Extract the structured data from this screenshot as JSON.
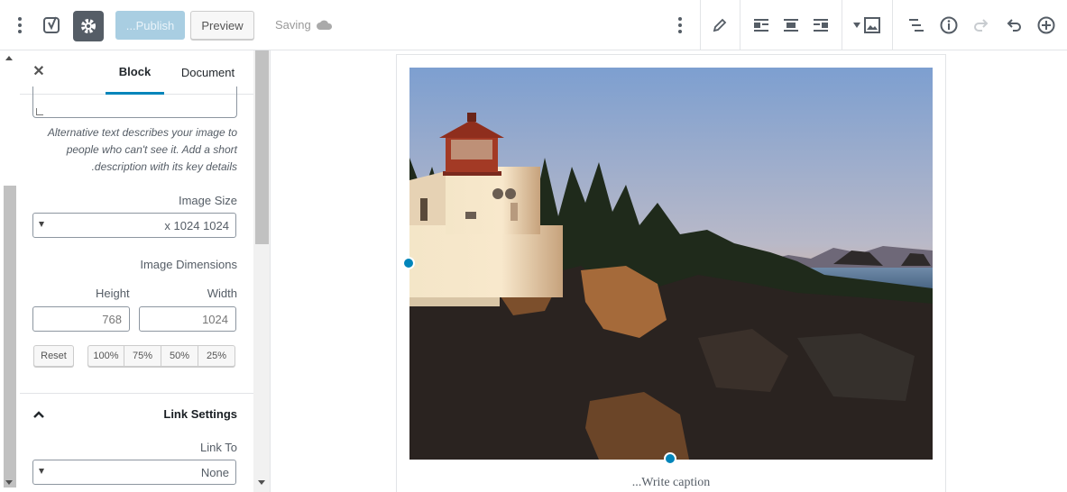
{
  "toolbar": {
    "publish_label": "...Publish",
    "preview_label": "Preview",
    "saving_label": "Saving"
  },
  "sidebar": {
    "tabs": [
      {
        "label": "Block",
        "active": true
      },
      {
        "label": "Document",
        "active": false
      }
    ],
    "alt_text_help": "Alternative text describes your image to people who can't see it. Add a short .description with its key details",
    "image_size_label": "Image Size",
    "image_size_value": "x 1024 1024",
    "image_dimensions_label": "Image Dimensions",
    "height_label": "Height",
    "width_label": "Width",
    "height_value": "768",
    "width_value": "1024",
    "reset_label": "Reset",
    "scale_options": [
      "100%",
      "75%",
      "50%",
      "25%"
    ],
    "link_settings_title": "Link Settings",
    "link_to_label": "Link To",
    "link_to_value": "None"
  },
  "canvas": {
    "caption_placeholder": "...Write caption"
  },
  "colors": {
    "accent": "#0085ba",
    "publish_disabled": "#a9cee2",
    "gear_bg": "#555d66"
  }
}
